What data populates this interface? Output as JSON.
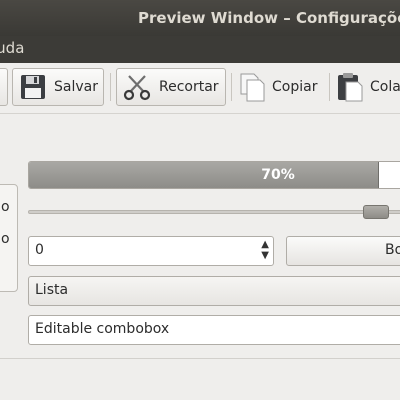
{
  "window": {
    "title": "Preview Window – Configuraçõe"
  },
  "menubar": {
    "help_label": "juda"
  },
  "toolbar": {
    "save_label": "Salvar",
    "cut_label": "Recortar",
    "copy_label": "Copiar",
    "paste_label": "Cola"
  },
  "left_panel": {
    "label1": "o",
    "label2": "o"
  },
  "progress": {
    "value": 0.7,
    "text": "70%"
  },
  "slider": {
    "value": 0.9
  },
  "spinbox": {
    "value": "0"
  },
  "button": {
    "label": "Bo"
  },
  "combobox": {
    "selected": "Lista"
  },
  "editable_combobox": {
    "value": "Editable combobox"
  }
}
